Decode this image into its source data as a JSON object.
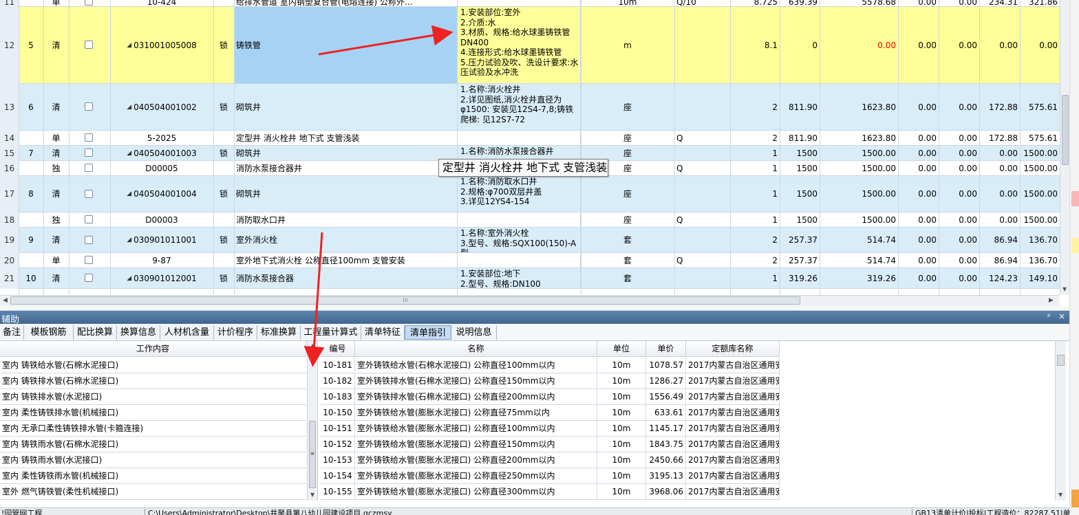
{
  "top_grid": {
    "rows": [
      {
        "row": "11",
        "seq": "",
        "type": "单",
        "code": "10-424",
        "lock": "",
        "name": "给排水管道 室内钢塑复合管(电熔连接) 公称外...",
        "feature": "",
        "unit": "10m",
        "formula": "Q/10",
        "qty": "8.725",
        "price": "639.39",
        "total": "5578.68",
        "c1": "0.00",
        "c2": "0.00",
        "c3": "234.31",
        "c4": "321.86"
      },
      {
        "row": "12",
        "seq": "5",
        "type": "清",
        "code": "031001005008",
        "lock": "锁",
        "name": "铸铁管",
        "feature": "1.安装部位:室外\n2.介质:水\n3.材质、规格:给水球墨铸铁管DN400\n4.连接形式:给水球墨铸铁管\n5.压力试验及吹、洗设计要求:水压试验及水冲洗",
        "unit": "m",
        "formula": "",
        "qty": "8.1",
        "price": "0",
        "total": "0.00",
        "c1": "0.00",
        "c2": "0.00",
        "c3": "0.00",
        "c4": "0.00"
      },
      {
        "row": "13",
        "seq": "6",
        "type": "清",
        "code": "040504001002",
        "lock": "锁",
        "name": "砌筑井",
        "feature": "1.名称:消火栓井\n2.详见图纸,消火栓井直径为φ1500: 安装见12S4-7,8;铸铁爬梯: 见12S7-72",
        "unit": "座",
        "formula": "",
        "qty": "2",
        "price": "811.90",
        "total": "1623.80",
        "c1": "0.00",
        "c2": "0.00",
        "c3": "172.88",
        "c4": "575.61"
      },
      {
        "row": "14",
        "seq": "",
        "type": "单",
        "code": "5-2025",
        "lock": "",
        "name": "定型井 消火栓井 地下式 支管浅装",
        "feature": "",
        "unit": "座",
        "formula": "Q",
        "qty": "2",
        "price": "811.90",
        "total": "1623.80",
        "c1": "0.00",
        "c2": "0.00",
        "c3": "172.88",
        "c4": "575.61"
      },
      {
        "row": "15",
        "seq": "7",
        "type": "清",
        "code": "040504001003",
        "lock": "锁",
        "name": "砌筑井",
        "feature": "1.名称:消防水泵接合器井",
        "unit": "座",
        "formula": "",
        "qty": "1",
        "price": "1500",
        "total": "1500.00",
        "c1": "0.00",
        "c2": "0.00",
        "c3": "0.00",
        "c4": "1500.00"
      },
      {
        "row": "16",
        "seq": "",
        "type": "独",
        "code": "D00005",
        "lock": "",
        "name": "消防水泵接合器井",
        "feature": "",
        "unit": "座",
        "formula": "Q",
        "qty": "1",
        "price": "1500",
        "total": "1500.00",
        "c1": "0.00",
        "c2": "0.00",
        "c3": "0.00",
        "c4": "1500.00"
      },
      {
        "row": "17",
        "seq": "8",
        "type": "清",
        "code": "040504001004",
        "lock": "锁",
        "name": "砌筑井",
        "feature": "1.名称:消防取水口井\n2.规格:φ700双层井盖\n3.详见12YS4-154",
        "unit": "座",
        "formula": "",
        "qty": "1",
        "price": "1500",
        "total": "1500.00",
        "c1": "0.00",
        "c2": "0.00",
        "c3": "0.00",
        "c4": "1500.00"
      },
      {
        "row": "18",
        "seq": "",
        "type": "独",
        "code": "D00003",
        "lock": "",
        "name": "消防取水口井",
        "feature": "",
        "unit": "座",
        "formula": "Q",
        "qty": "1",
        "price": "1500",
        "total": "1500.00",
        "c1": "0.00",
        "c2": "0.00",
        "c3": "0.00",
        "c4": "1500.00"
      },
      {
        "row": "19",
        "seq": "9",
        "type": "清",
        "code": "030901011001",
        "lock": "锁",
        "name": "室外消火栓",
        "feature": "1.名称:室外消火栓\n3.型号、规格:SQX100(150)-A型",
        "unit": "套",
        "formula": "",
        "qty": "2",
        "price": "257.37",
        "total": "514.74",
        "c1": "0.00",
        "c2": "0.00",
        "c3": "86.94",
        "c4": "136.70"
      },
      {
        "row": "20",
        "seq": "",
        "type": "单",
        "code": "9-87",
        "lock": "",
        "name": "室外地下式消火栓 公称直径100mm 支管安装",
        "feature": "",
        "unit": "套",
        "formula": "Q",
        "qty": "2",
        "price": "257.37",
        "total": "514.74",
        "c1": "0.00",
        "c2": "0.00",
        "c3": "86.94",
        "c4": "136.70"
      },
      {
        "row": "21",
        "seq": "10",
        "type": "清",
        "code": "030901012001",
        "lock": "锁",
        "name": "消防水泵接合器",
        "feature": "1.安装部位:地下\n2.型号、规格:DN100",
        "unit": "套",
        "formula": "",
        "qty": "1",
        "price": "319.26",
        "total": "319.26",
        "c1": "0.00",
        "c2": "0.00",
        "c3": "124.23",
        "c4": "149.10"
      }
    ]
  },
  "tooltip": "定型井 消火栓井 地下式 支管浅装",
  "scroll_grip": "⁞⁞⁞",
  "aux_panel": {
    "title": "辅助",
    "pin_icon": "pin-icon",
    "close_icon": "close-icon",
    "tabs": [
      "备注",
      "模板钢筋",
      "配比换算",
      "换算信息",
      "人材机含量",
      "计价程序",
      "标准换算",
      "工程量计算式",
      "清单特征",
      "清单指引",
      "说明信息"
    ],
    "active_tab": "清单指引",
    "left_header": "工作内容",
    "left_items": [
      "室内 铸铁给水管(石棉水泥接口)",
      "室内 铸铁排水管(石棉水泥接口)",
      "室内 铸铁排水管(水泥接口)",
      "室内 柔性铸铁排水管(机械接口)",
      "室内 无承口柔性铸铁排水管(卡箍连接)",
      "室内 铸铁雨水管(石棉水泥接口)",
      "室内 铸铁雨水管(水泥接口)",
      "室内 柔性铸铁雨水管(机械接口)",
      "室外 燃气铸铁管(柔性机械接口)"
    ],
    "right_headers": {
      "code": "编号",
      "name": "名称",
      "unit": "单位",
      "price": "单价",
      "lib": "定额库名称"
    },
    "right_rows": [
      {
        "code": "10-181",
        "name": "室外铸铁给水管(石棉水泥接口) 公称直径100mm以内",
        "unit": "10m",
        "price": "1078.57",
        "lib": "2017内蒙古自治区通用安装工..."
      },
      {
        "code": "10-182",
        "name": "室外铸铁排水管(石棉水泥接口) 公称直径150mm以内",
        "unit": "10m",
        "price": "1286.27",
        "lib": "2017内蒙古自治区通用安装工..."
      },
      {
        "code": "10-183",
        "name": "室外铸铁排水管(石棉水泥接口) 公称直径200mm以内",
        "unit": "10m",
        "price": "1556.49",
        "lib": "2017内蒙古自治区通用安装工..."
      },
      {
        "code": "10-150",
        "name": "室外铸铁给水管(膨胀水泥接口) 公称直径75mm以内",
        "unit": "10m",
        "price": "633.61",
        "lib": "2017内蒙古自治区通用安装工..."
      },
      {
        "code": "10-151",
        "name": "室外铸铁给水管(膨胀水泥接口) 公称直径100mm以内",
        "unit": "10m",
        "price": "1145.17",
        "lib": "2017内蒙古自治区通用安装工..."
      },
      {
        "code": "10-152",
        "name": "室外铸铁给水管(膨胀水泥接口) 公称直径150mm以内",
        "unit": "10m",
        "price": "1843.75",
        "lib": "2017内蒙古自治区通用安装工..."
      },
      {
        "code": "10-153",
        "name": "室外铸铁给水管(膨胀水泥接口) 公称直径200mm以内",
        "unit": "10m",
        "price": "2450.66",
        "lib": "2017内蒙古自治区通用安装工..."
      },
      {
        "code": "10-154",
        "name": "室外铸铁给水管(膨胀水泥接口) 公称直径250mm以内",
        "unit": "10m",
        "price": "3195.13",
        "lib": "2017内蒙古自治区通用安装工..."
      },
      {
        "code": "10-155",
        "name": "室外铸铁给水管(膨胀水泥接口) 公称直径300mm以内",
        "unit": "10m",
        "price": "3968.06",
        "lib": "2017内蒙古自治区通用安装工..."
      }
    ]
  },
  "status_bar": {
    "left": "!园管网工程",
    "path": "C:\\Users\\Administrator\\Desktop\\井聚县第八幼儿园建设项目.gczmsy",
    "right": "GB13清单计价|投标|工程造价：82287.51|单..."
  },
  "colors": {
    "highlight_row": "#ffff99",
    "list_row": "#d9edf8",
    "selected_cell": "#a6d3f5",
    "tab_active": "#c4dbf2",
    "arrow": "#ee2222",
    "red_text": "#ff0000"
  }
}
